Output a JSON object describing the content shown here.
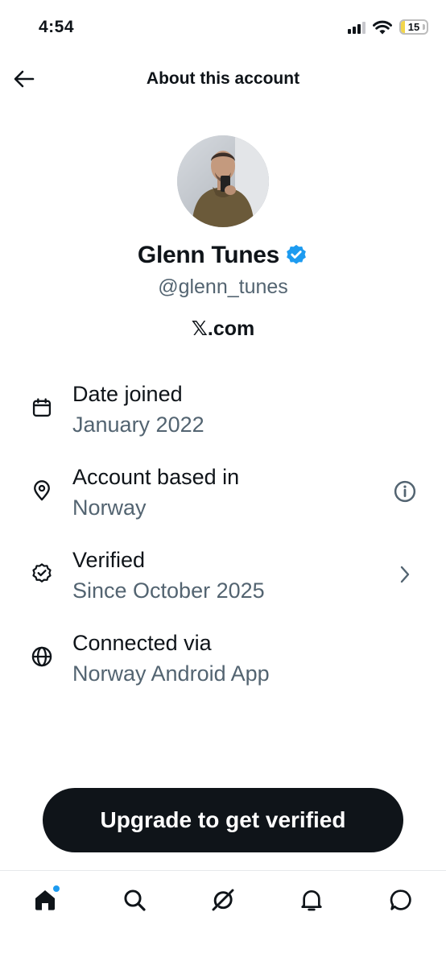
{
  "status_bar": {
    "time": "4:54",
    "battery": "15",
    "battery_level": 0.15
  },
  "header": {
    "title": "About this account"
  },
  "profile": {
    "name": "Glenn Tunes",
    "verified_icon": "verified-badge-icon",
    "handle": "@glenn_tunes",
    "platform": "𝕏.com"
  },
  "details": [
    {
      "icon": "calendar-icon",
      "label": "Date joined",
      "value": "January 2022"
    },
    {
      "icon": "location-pin-icon",
      "label": "Account based in",
      "value": "Norway",
      "action_icon": "info-icon"
    },
    {
      "icon": "verified-outline-icon",
      "label": "Verified",
      "value": "Since October 2025",
      "action_icon": "chevron-right-icon"
    },
    {
      "icon": "globe-icon",
      "label": "Connected via",
      "value": "Norway Android App"
    }
  ],
  "cta": {
    "label": "Upgrade to get verified"
  },
  "bottom_nav": {
    "items": [
      "home-icon",
      "search-icon",
      "grok-icon",
      "notifications-icon",
      "messages-icon"
    ],
    "active": "home-icon"
  },
  "colors": {
    "accent": "#1d9bf0",
    "text": "#0f1419",
    "secondary": "#536471",
    "button": "#0f1419"
  }
}
